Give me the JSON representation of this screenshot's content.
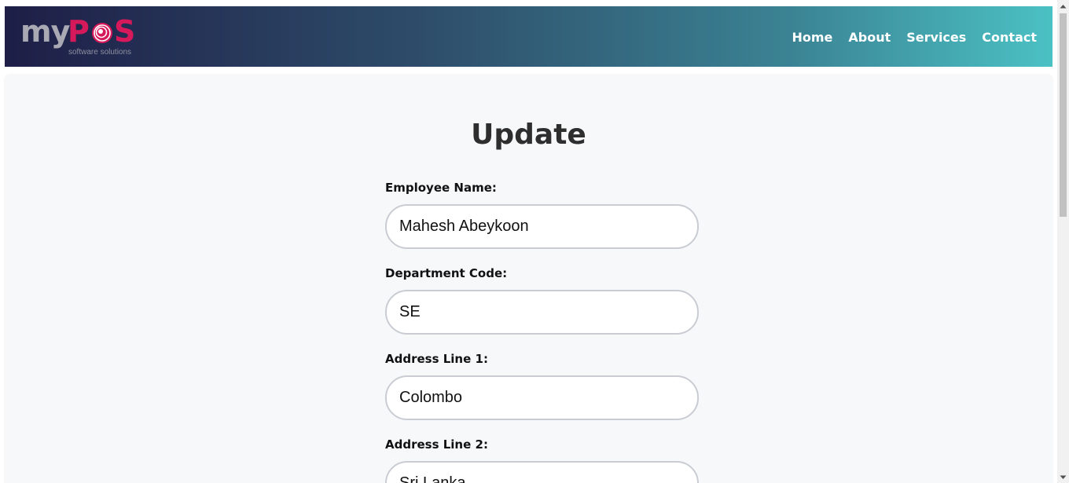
{
  "brand": {
    "logo_text_my": "my",
    "logo_text_p": "P",
    "logo_text_s": "S",
    "tagline": "software solutions",
    "colors": {
      "grey": "#a8a9b3",
      "accent": "#d5195a"
    }
  },
  "nav": {
    "items": [
      {
        "label": "Home"
      },
      {
        "label": "About"
      },
      {
        "label": "Services"
      },
      {
        "label": "Contact"
      }
    ]
  },
  "page": {
    "title": "Update"
  },
  "form": {
    "fields": [
      {
        "label": "Employee Name:",
        "value": "Mahesh Abeykoon"
      },
      {
        "label": "Department Code:",
        "value": "SE"
      },
      {
        "label": "Address Line 1:",
        "value": "Colombo"
      },
      {
        "label": "Address Line 2:",
        "value": "Sri Lanka"
      }
    ]
  },
  "theme": {
    "header_gradient_start": "#1e1e47",
    "header_gradient_end": "#4bc1c4",
    "content_bg": "#f7f8fa",
    "input_border": "#c9ccd3"
  }
}
